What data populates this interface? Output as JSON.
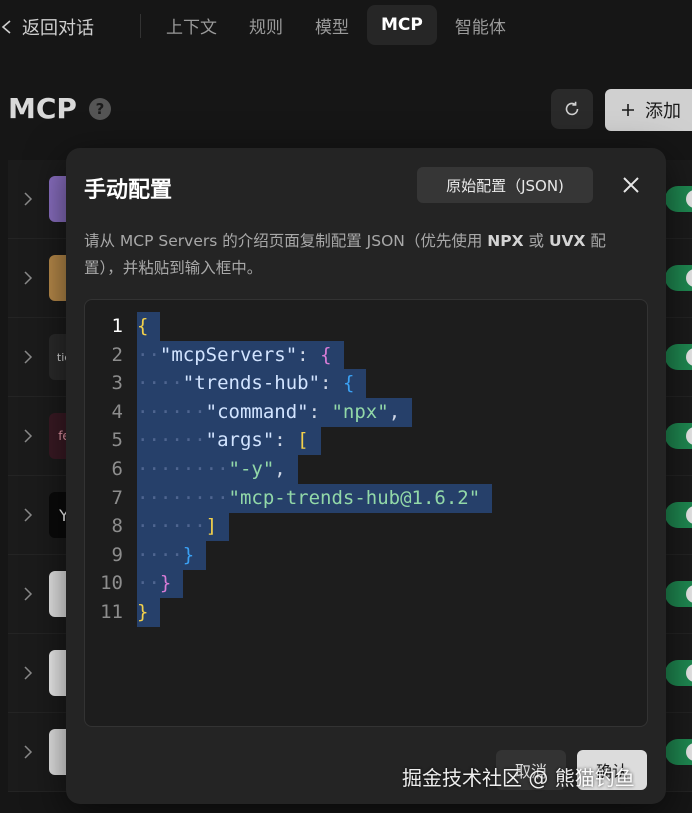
{
  "topnav": {
    "back_label": "返回对话",
    "tabs": [
      {
        "label": "上下文",
        "active": false
      },
      {
        "label": "规则",
        "active": false
      },
      {
        "label": "模型",
        "active": false
      },
      {
        "label": "MCP",
        "active": true
      },
      {
        "label": "智能体",
        "active": false
      }
    ]
  },
  "page": {
    "title": "MCP",
    "help_glyph": "?",
    "add_label": "添加"
  },
  "server_logos": [
    {
      "color": "#8a6fc2",
      "text": ""
    },
    {
      "color": "#b98b4a",
      "text": ""
    },
    {
      "color": "#2b2b2b",
      "text": "tie"
    },
    {
      "color": "#3a1a24",
      "text": "fe"
    },
    {
      "color": "#0a0a0a",
      "text": "Y"
    },
    {
      "color": "#e8e8e8",
      "text": ""
    },
    {
      "color": "#f0f0f0",
      "text": ""
    },
    {
      "color": "#e6e6e6",
      "text": ""
    }
  ],
  "modal": {
    "title": "手动配置",
    "raw_config_label": "原始配置（JSON)",
    "description_before": "请从 MCP Servers 的介绍页面复制配置 JSON（优先使用 ",
    "description_npx": "NPX",
    "description_or": " 或 ",
    "description_uvx": "UVX",
    "description_after": " 配置），并粘贴到输入框中。",
    "cancel_label": "取消",
    "ok_label": "确认"
  },
  "editor": {
    "lines": [
      {
        "no": "1",
        "dots": "",
        "parts": [
          {
            "t": "{",
            "c": "b-y"
          }
        ]
      },
      {
        "no": "2",
        "dots": "··",
        "parts": [
          {
            "t": "\"mcpServers\"",
            "c": "key"
          },
          {
            "t": ": ",
            "c": "punc"
          },
          {
            "t": "{",
            "c": "b-p"
          }
        ]
      },
      {
        "no": "3",
        "dots": "····",
        "parts": [
          {
            "t": "\"trends-hub\"",
            "c": "key"
          },
          {
            "t": ": ",
            "c": "punc"
          },
          {
            "t": "{",
            "c": "b-b"
          }
        ]
      },
      {
        "no": "4",
        "dots": "······",
        "parts": [
          {
            "t": "\"command\"",
            "c": "key"
          },
          {
            "t": ": ",
            "c": "punc"
          },
          {
            "t": "\"npx\"",
            "c": "str"
          },
          {
            "t": ",",
            "c": "punc"
          }
        ]
      },
      {
        "no": "5",
        "dots": "······",
        "parts": [
          {
            "t": "\"args\"",
            "c": "key"
          },
          {
            "t": ": ",
            "c": "punc"
          },
          {
            "t": "[",
            "c": "b-y"
          }
        ]
      },
      {
        "no": "6",
        "dots": "········",
        "parts": [
          {
            "t": "\"-y\"",
            "c": "str"
          },
          {
            "t": ",",
            "c": "punc"
          }
        ]
      },
      {
        "no": "7",
        "dots": "········",
        "parts": [
          {
            "t": "\"mcp-trends-hub@1.6.2\"",
            "c": "str"
          }
        ]
      },
      {
        "no": "8",
        "dots": "······",
        "parts": [
          {
            "t": "]",
            "c": "b-y"
          }
        ]
      },
      {
        "no": "9",
        "dots": "····",
        "parts": [
          {
            "t": "}",
            "c": "b-b"
          }
        ]
      },
      {
        "no": "10",
        "dots": "··",
        "parts": [
          {
            "t": "}",
            "c": "b-p"
          }
        ]
      },
      {
        "no": "11",
        "dots": "",
        "parts": [
          {
            "t": "}",
            "c": "b-y"
          }
        ]
      }
    ]
  },
  "watermark": "掘金技术社区 @ 熊猫钓鱼"
}
